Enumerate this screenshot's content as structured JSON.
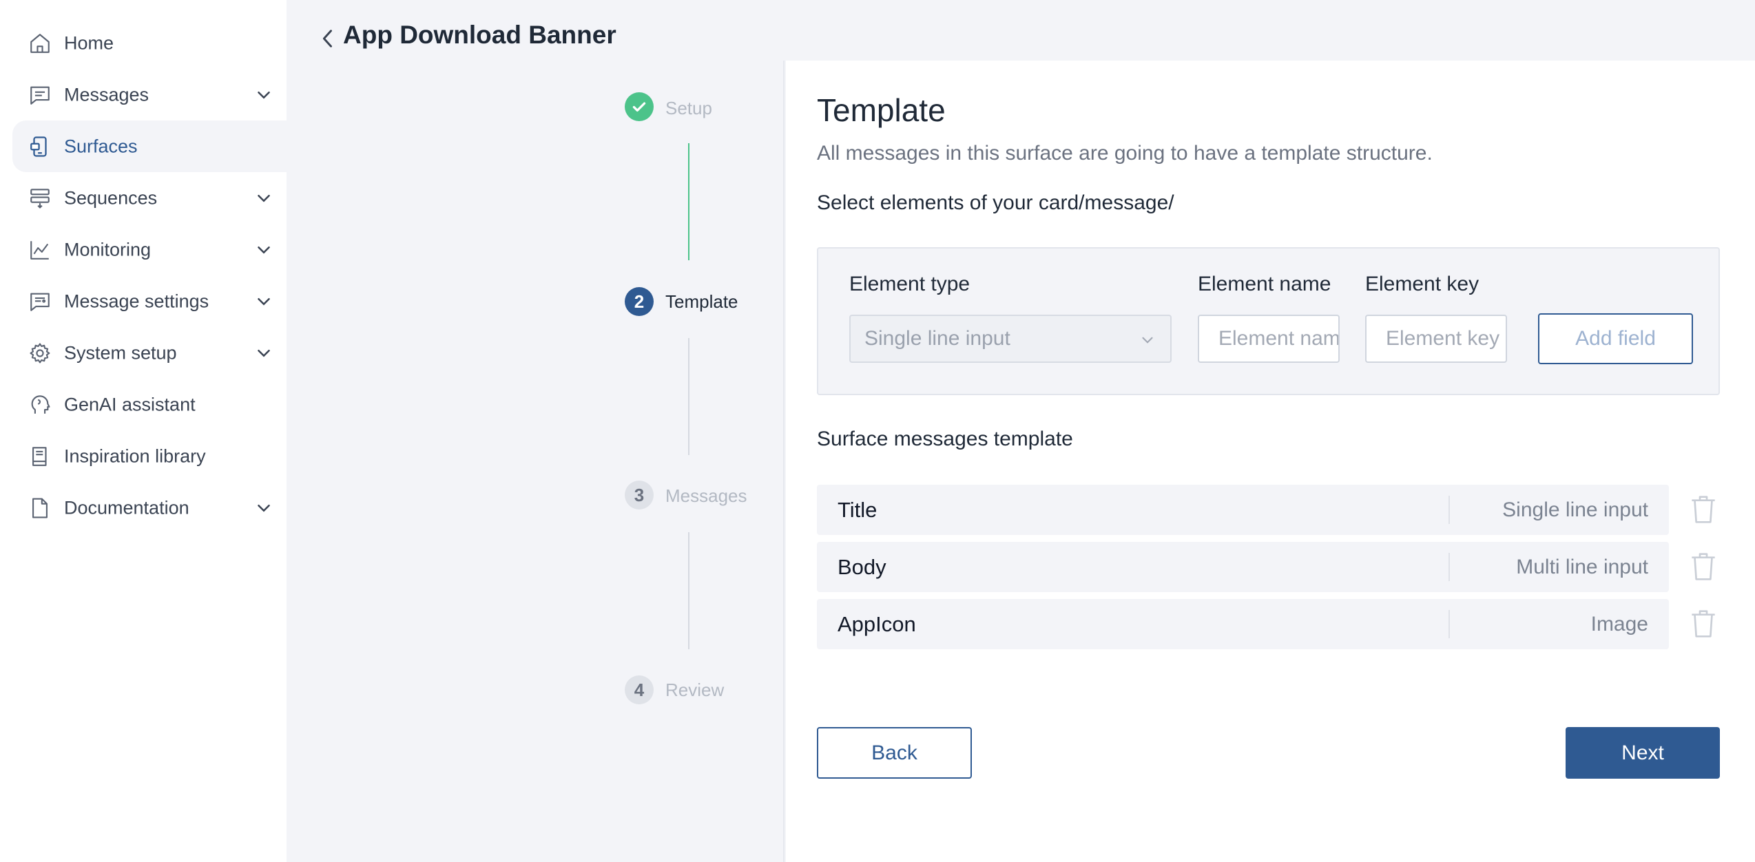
{
  "sidebar": {
    "items": [
      {
        "label": "Home",
        "icon": "home-icon"
      },
      {
        "label": "Messages",
        "icon": "message-icon",
        "expandable": true
      },
      {
        "label": "Surfaces",
        "icon": "surfaces-icon",
        "active": true
      },
      {
        "label": "Sequences",
        "icon": "sequences-icon",
        "expandable": true
      },
      {
        "label": "Monitoring",
        "icon": "chart-icon",
        "expandable": true
      },
      {
        "label": "Message settings",
        "icon": "message-settings-icon",
        "expandable": true
      },
      {
        "label": "System setup",
        "icon": "gear-icon",
        "expandable": true
      },
      {
        "label": "GenAI assistant",
        "icon": "ai-head-icon"
      },
      {
        "label": "Inspiration library",
        "icon": "book-icon"
      },
      {
        "label": "Documentation",
        "icon": "document-icon",
        "expandable": true
      }
    ]
  },
  "header": {
    "title": "App Download Banner"
  },
  "stepper": {
    "steps": [
      {
        "number": "",
        "label": "Setup",
        "state": "completed"
      },
      {
        "number": "2",
        "label": "Template",
        "state": "active"
      },
      {
        "number": "3",
        "label": "Messages",
        "state": "pending"
      },
      {
        "number": "4",
        "label": "Review",
        "state": "pending"
      }
    ]
  },
  "main": {
    "title": "Template",
    "subtitle": "All messages in this surface are going to have a template structure.",
    "select_label": "Select elements of your card/message/",
    "form": {
      "element_type_label": "Element type",
      "element_type_value": "Single line input",
      "element_name_label": "Element name",
      "element_name_placeholder": "Element name",
      "element_key_label": "Element key",
      "element_key_placeholder": "Element key",
      "add_field_label": "Add field"
    },
    "template_heading": "Surface messages template",
    "template_rows": [
      {
        "name": "Title",
        "type": "Single line input"
      },
      {
        "name": "Body",
        "type": "Multi line input"
      },
      {
        "name": "AppIcon",
        "type": "Image"
      }
    ],
    "back_label": "Back",
    "next_label": "Next"
  },
  "colors": {
    "primary": "#2f5a92",
    "success": "#4cc38a",
    "background": "#f3f4f8"
  }
}
